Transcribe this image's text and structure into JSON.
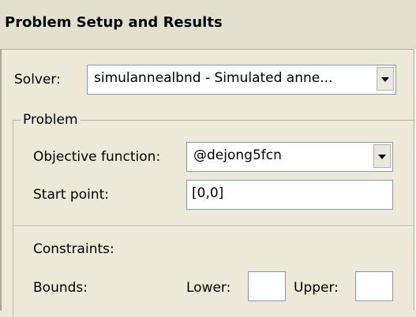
{
  "header": {
    "title": "Problem Setup and Results"
  },
  "solver": {
    "label": "Solver:",
    "selected": "simulannealbnd - Simulated anne..."
  },
  "problem": {
    "legend": "Problem",
    "objective_label": "Objective function:",
    "objective_value": "@dejong5fcn",
    "start_label": "Start point:",
    "start_value": "[0,0]"
  },
  "constraints": {
    "heading": "Constraints:",
    "bounds_label": "Bounds:",
    "lower_label": "Lower:",
    "lower_value": "",
    "upper_label": "Upper:",
    "upper_value": ""
  },
  "icons": {
    "dropdown": "chevron-down-icon"
  },
  "colors": {
    "window_bg": "#ece9d8",
    "field_border": "#7f9db9",
    "field_bg": "#ffffff"
  }
}
